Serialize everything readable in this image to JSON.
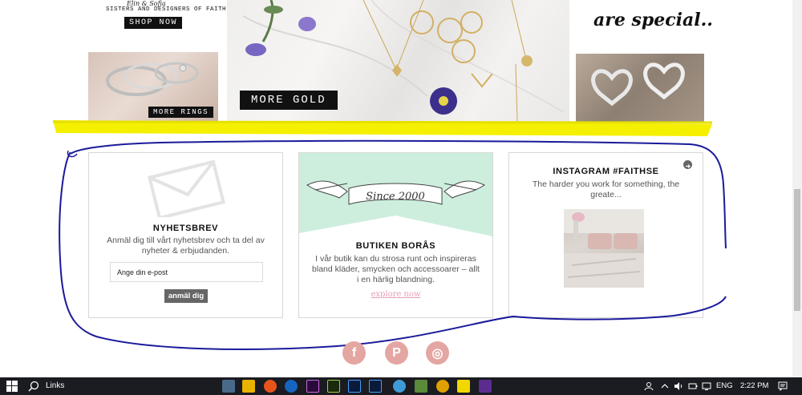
{
  "hero": {
    "brand_script": "Elin & Sofia",
    "brand_tagline": "SISTERS AND DESIGNERS OF FAITH",
    "shop_now_label": "SHOP NOW",
    "more_rings_label": "MORE RINGS",
    "more_gold_label": "MORE GOLD",
    "special_text": "are special.."
  },
  "newsletter": {
    "title": "NYHETSBREV",
    "text": "Anmäl dig till vårt nyhetsbrev och ta del av nyheter & erbjudanden.",
    "email_placeholder": "Ange din e-post",
    "signup_label": "anmäl dig"
  },
  "store": {
    "banner_text": "Since 2000",
    "title": "BUTIKEN BORÅS",
    "text": "I vår butik kan du strosa runt och inspireras bland kläder, smycken och accessoarer – allt i en härlig blandning.",
    "explore_label": "explore now"
  },
  "instagram": {
    "title": "INSTAGRAM #FAITHSE",
    "text": "The harder you work for something, the greate..."
  },
  "social": {
    "facebook_glyph": "f",
    "pinterest_glyph": "P",
    "instagram_glyph": "◎"
  },
  "taskbar": {
    "search_label": "Links",
    "language": "ENG",
    "time": "2:22 PM"
  },
  "colors": {
    "highlight": "#f5f000",
    "scribble": "#1a1a9a",
    "store_mint": "#cdeedd",
    "social_pink": "#e4a6a2",
    "link_pink": "#e6a0b4",
    "taskbar": "#1b1b22"
  }
}
